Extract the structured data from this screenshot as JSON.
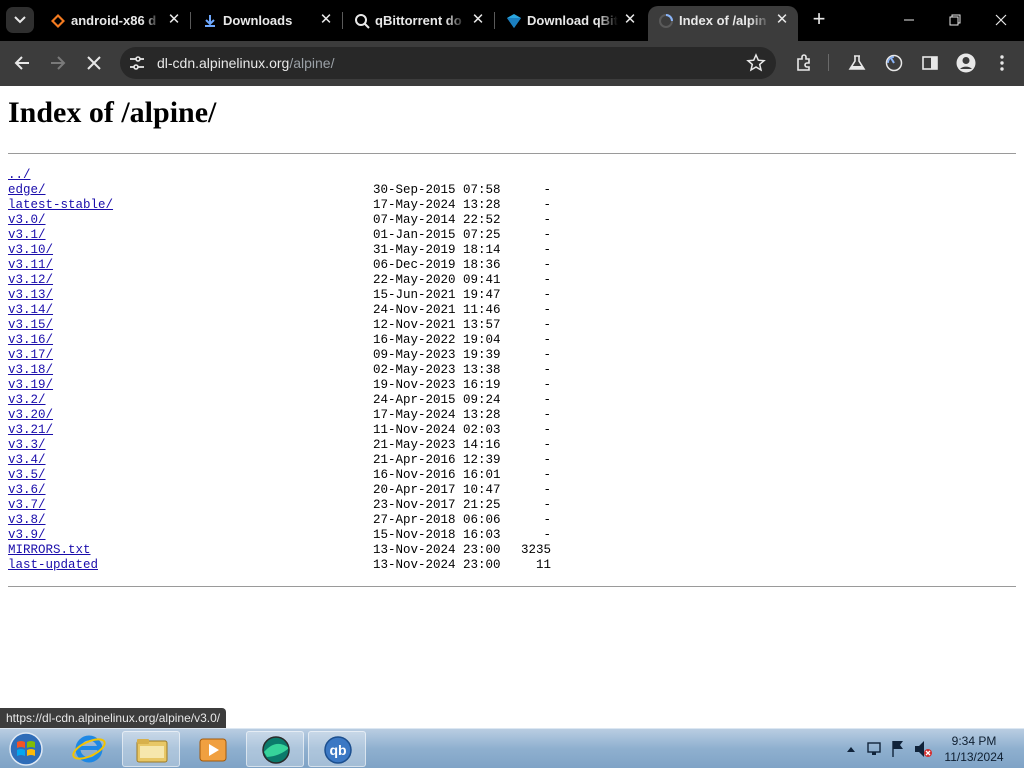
{
  "tabs": [
    {
      "title": "android-x86 d",
      "icon": "android-x86-icon"
    },
    {
      "title": "Downloads",
      "icon": "download-icon"
    },
    {
      "title": "qBittorrent do",
      "icon": "search-icon"
    },
    {
      "title": "Download qBit",
      "icon": "brand-diamond-icon"
    },
    {
      "title": "Index of /alpin",
      "icon": "loading-icon",
      "active": true
    }
  ],
  "address": {
    "host": "dl-cdn.alpinelinux.org",
    "path": "/alpine/"
  },
  "page": {
    "heading": "Index of /alpine/",
    "parent": "../",
    "entries": [
      {
        "name": "edge/",
        "date": "30-Sep-2015 07:58",
        "size": "-"
      },
      {
        "name": "latest-stable/",
        "date": "17-May-2024 13:28",
        "size": "-"
      },
      {
        "name": "v3.0/",
        "date": "07-May-2014 22:52",
        "size": "-"
      },
      {
        "name": "v3.1/",
        "date": "01-Jan-2015 07:25",
        "size": "-"
      },
      {
        "name": "v3.10/",
        "date": "31-May-2019 18:14",
        "size": "-"
      },
      {
        "name": "v3.11/",
        "date": "06-Dec-2019 18:36",
        "size": "-"
      },
      {
        "name": "v3.12/",
        "date": "22-May-2020 09:41",
        "size": "-"
      },
      {
        "name": "v3.13/",
        "date": "15-Jun-2021 19:47",
        "size": "-"
      },
      {
        "name": "v3.14/",
        "date": "24-Nov-2021 11:46",
        "size": "-"
      },
      {
        "name": "v3.15/",
        "date": "12-Nov-2021 13:57",
        "size": "-"
      },
      {
        "name": "v3.16/",
        "date": "16-May-2022 19:04",
        "size": "-"
      },
      {
        "name": "v3.17/",
        "date": "09-May-2023 19:39",
        "size": "-"
      },
      {
        "name": "v3.18/",
        "date": "02-May-2023 13:38",
        "size": "-"
      },
      {
        "name": "v3.19/",
        "date": "19-Nov-2023 16:19",
        "size": "-"
      },
      {
        "name": "v3.2/",
        "date": "24-Apr-2015 09:24",
        "size": "-"
      },
      {
        "name": "v3.20/",
        "date": "17-May-2024 13:28",
        "size": "-"
      },
      {
        "name": "v3.21/",
        "date": "11-Nov-2024 02:03",
        "size": "-"
      },
      {
        "name": "v3.3/",
        "date": "21-May-2023 14:16",
        "size": "-"
      },
      {
        "name": "v3.4/",
        "date": "21-Apr-2016 12:39",
        "size": "-"
      },
      {
        "name": "v3.5/",
        "date": "16-Nov-2016 16:01",
        "size": "-"
      },
      {
        "name": "v3.6/",
        "date": "20-Apr-2017 10:47",
        "size": "-"
      },
      {
        "name": "v3.7/",
        "date": "23-Nov-2017 21:25",
        "size": "-"
      },
      {
        "name": "v3.8/",
        "date": "27-Apr-2018 06:06",
        "size": "-"
      },
      {
        "name": "v3.9/",
        "date": "15-Nov-2018 16:03",
        "size": "-"
      },
      {
        "name": "MIRRORS.txt",
        "date": "13-Nov-2024 23:00",
        "size": "3235"
      },
      {
        "name": "last-updated",
        "date": "13-Nov-2024 23:00",
        "size": "11"
      }
    ]
  },
  "status_url": "https://dl-cdn.alpinelinux.org/alpine/v3.0/",
  "taskbar": {
    "items": [
      "internet-explorer-icon",
      "file-explorer-icon",
      "media-player-icon",
      "app-globe-icon",
      "qbittorrent-icon"
    ],
    "clock_time": "9:34 PM",
    "clock_date": "11/13/2024"
  },
  "colors": {
    "link": "#1a0dab",
    "tab_strip": "#000000",
    "toolbar": "#3c3c3c",
    "omnibox": "#282828"
  }
}
